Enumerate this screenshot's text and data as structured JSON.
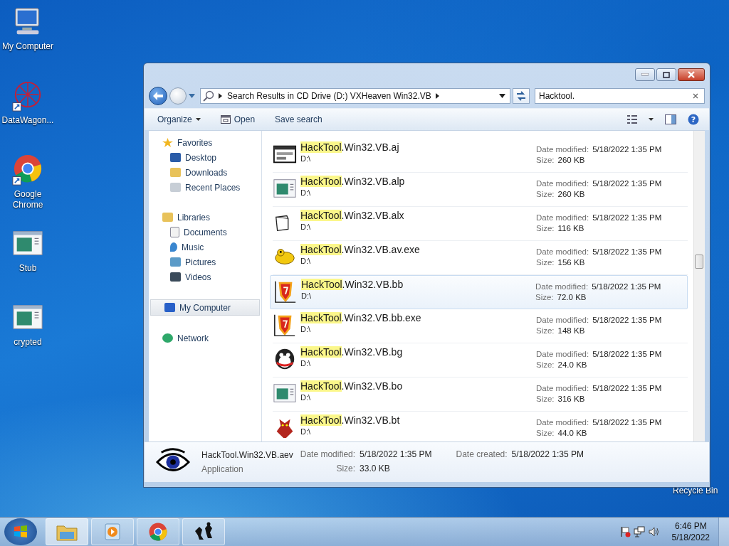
{
  "desktop_icons": [
    {
      "label": "My Computer",
      "kind": "computer"
    },
    {
      "label": "DataWagon...",
      "kind": "web"
    },
    {
      "label": "Google Chrome",
      "kind": "chrome"
    },
    {
      "label": "Stub",
      "kind": "app"
    },
    {
      "label": "crypted",
      "kind": "app"
    }
  ],
  "recycle_bin": {
    "label": "Recycle Bin"
  },
  "window": {
    "address": {
      "path": "Search Results in CD Drive (D:) VXHeaven Win32.VB"
    },
    "search": {
      "value": "Hacktool."
    },
    "toolbar": [
      {
        "label": "Organize",
        "kind": "menu"
      },
      {
        "label": "Open",
        "kind": "open"
      },
      {
        "label": "Save search",
        "kind": "plain"
      }
    ],
    "nav": [
      {
        "label": "Favorites",
        "kind": "star",
        "selected": false,
        "children": [
          {
            "label": "Desktop",
            "kind": "desktop",
            "selected": false
          },
          {
            "label": "Downloads",
            "kind": "downloads",
            "selected": false
          },
          {
            "label": "Recent Places",
            "kind": "recent",
            "selected": false
          }
        ]
      },
      {
        "label": "Libraries",
        "kind": "library",
        "selected": false,
        "children": [
          {
            "label": "Documents",
            "kind": "documents",
            "selected": false
          },
          {
            "label": "Music",
            "kind": "music",
            "selected": false
          },
          {
            "label": "Pictures",
            "kind": "pictures",
            "selected": false
          },
          {
            "label": "Videos",
            "kind": "videos",
            "selected": false
          }
        ]
      },
      {
        "label": "My Computer",
        "kind": "computer",
        "selected": true
      },
      {
        "label": "Network",
        "kind": "network",
        "selected": false
      }
    ],
    "help": {
      "glyph": "?"
    },
    "files": [
      {
        "match": "HackTool",
        "rest": ".Win32.VB.aj",
        "location": "D:\\",
        "modified_label": "Date modified:",
        "modified": "5/18/2022 1:35 PM",
        "size_label": "Size:",
        "size": "260 KB",
        "kind": "window",
        "selected": false
      },
      {
        "match": "HackTool",
        "rest": ".Win32.VB.alp",
        "location": "D:\\",
        "modified_label": "Date modified:",
        "modified": "5/18/2022 1:35 PM",
        "size_label": "Size:",
        "size": "260 KB",
        "kind": "app",
        "selected": false
      },
      {
        "match": "HackTool",
        "rest": ".Win32.VB.alx",
        "location": "D:\\",
        "modified_label": "Date modified:",
        "modified": "5/18/2022 1:35 PM",
        "size_label": "Size:",
        "size": "116 KB",
        "kind": "blank",
        "selected": false
      },
      {
        "match": "HackTool",
        "rest": ".Win32.VB.av.exe",
        "location": "D:\\",
        "modified_label": "Date modified:",
        "modified": "5/18/2022 1:35 PM",
        "size_label": "Size:",
        "size": "156 KB",
        "kind": "yellow",
        "selected": false
      },
      {
        "match": "HackTool",
        "rest": ".Win32.VB.bb",
        "location": "D:\\",
        "modified_label": "Date modified:",
        "modified": "5/18/2022 1:35 PM",
        "size_label": "Size:",
        "size": "72.0 KB",
        "kind": "red",
        "selected": true
      },
      {
        "match": "HackTool",
        "rest": ".Win32.VB.bb.exe",
        "location": "D:\\",
        "modified_label": "Date modified:",
        "modified": "5/18/2022 1:35 PM",
        "size_label": "Size:",
        "size": "148 KB",
        "kind": "red",
        "selected": false
      },
      {
        "match": "HackTool",
        "rest": ".Win32.VB.bg",
        "location": "D:\\",
        "modified_label": "Date modified:",
        "modified": "5/18/2022 1:35 PM",
        "size_label": "Size:",
        "size": "24.0 KB",
        "kind": "penguin",
        "selected": false
      },
      {
        "match": "HackTool",
        "rest": ".Win32.VB.bo",
        "location": "D:\\",
        "modified_label": "Date modified:",
        "modified": "5/18/2022 1:35 PM",
        "size_label": "Size:",
        "size": "316 KB",
        "kind": "app",
        "selected": false
      },
      {
        "match": "HackTool",
        "rest": ".Win32.VB.bt",
        "location": "D:\\",
        "modified_label": "Date modified:",
        "modified": "5/18/2022 1:35 PM",
        "size_label": "Size:",
        "size": "44.0 KB",
        "kind": "monster",
        "selected": false
      }
    ],
    "details": {
      "name": "HackTool.Win32.VB.aev",
      "type": "Application",
      "modified_label": "Date modified:",
      "modified": "5/18/2022 1:35 PM",
      "size_label": "Size:",
      "size": "33.0 KB",
      "created_label": "Date created:",
      "created": "5/18/2022 1:35 PM"
    }
  },
  "taskbar": {
    "buttons": [
      {
        "kind": "explorer",
        "selected": true
      },
      {
        "kind": "media",
        "selected": false
      },
      {
        "kind": "chrome",
        "selected": false
      },
      {
        "kind": "figures",
        "selected": false
      }
    ],
    "time": "6:46 PM",
    "date": "5/18/2022"
  }
}
